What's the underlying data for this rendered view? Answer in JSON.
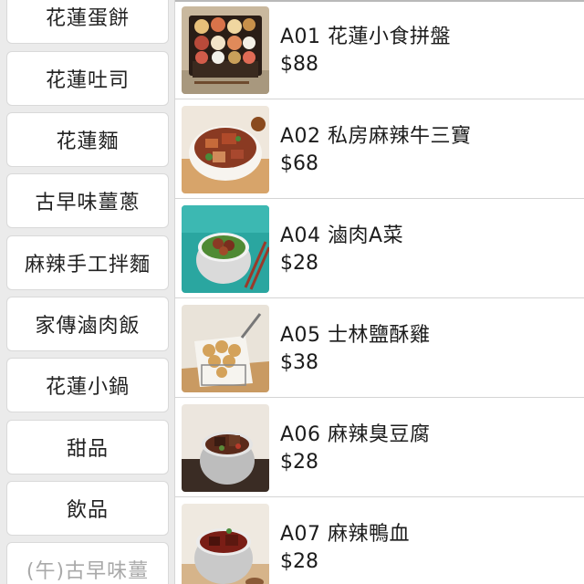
{
  "categories": [
    {
      "label": "花蓮蛋餅",
      "dimmed": false
    },
    {
      "label": "花蓮吐司",
      "dimmed": false
    },
    {
      "label": "花蓮麵",
      "dimmed": false
    },
    {
      "label": "古早味薑蔥",
      "dimmed": false
    },
    {
      "label": "麻辣手工拌麵",
      "dimmed": false
    },
    {
      "label": "家傳滷肉飯",
      "dimmed": false
    },
    {
      "label": "花蓮小鍋",
      "dimmed": false
    },
    {
      "label": "甜品",
      "dimmed": false
    },
    {
      "label": "飲品",
      "dimmed": false
    },
    {
      "label": "(午)古早味薑",
      "dimmed": true
    }
  ],
  "menu_items": [
    {
      "name": "A01 花蓮小食拼盤",
      "price": "$88",
      "image": "snack-platter-photo"
    },
    {
      "name": "A02 私房麻辣牛三寶",
      "price": "$68",
      "image": "spicy-beef-photo"
    },
    {
      "name": "A04 滷肉A菜",
      "price": "$28",
      "image": "braised-pork-lettuce-photo"
    },
    {
      "name": "A05 士林鹽酥雞",
      "price": "$38",
      "image": "fried-chicken-photo"
    },
    {
      "name": "A06 麻辣臭豆腐",
      "price": "$28",
      "image": "stinky-tofu-photo"
    },
    {
      "name": "A07 麻辣鴨血",
      "price": "$28",
      "image": "duck-blood-photo"
    }
  ]
}
